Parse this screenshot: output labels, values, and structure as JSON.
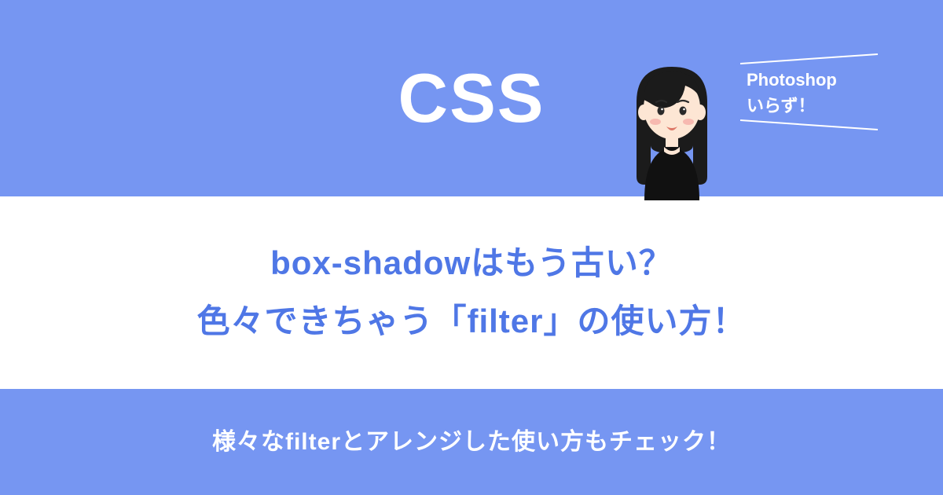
{
  "hero": {
    "label": "CSS"
  },
  "callout": {
    "line1": "Photoshop",
    "line2": "いらず！"
  },
  "title": {
    "line1": "box-shadowはもう古い？",
    "line2": "色々できちゃう「filter」の使い方！"
  },
  "subtitle": "様々なfilterとアレンジした使い方もチェック！"
}
